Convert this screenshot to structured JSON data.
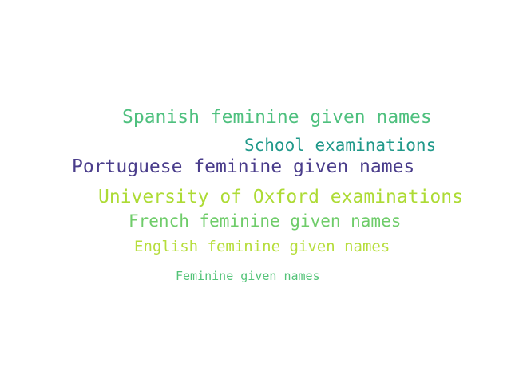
{
  "word_cloud": {
    "words": [
      {
        "text": "Spanish feminine given names",
        "color": "#4ec07e",
        "weight": 0.83
      },
      {
        "text": "School examinations",
        "color": "#20998a",
        "weight": 0.75
      },
      {
        "text": "Portuguese feminine given names",
        "color": "#4a3d8b",
        "weight": 0.88
      },
      {
        "text": "University of Oxford examinations",
        "color": "#addb35",
        "weight": 0.82
      },
      {
        "text": "French feminine given names",
        "color": "#6fcc6a",
        "weight": 0.78
      },
      {
        "text": "English feminine given names",
        "color": "#b6dd3c",
        "weight": 0.7
      },
      {
        "text": "Feminine given names",
        "color": "#53c378",
        "weight": 0.53
      }
    ]
  }
}
